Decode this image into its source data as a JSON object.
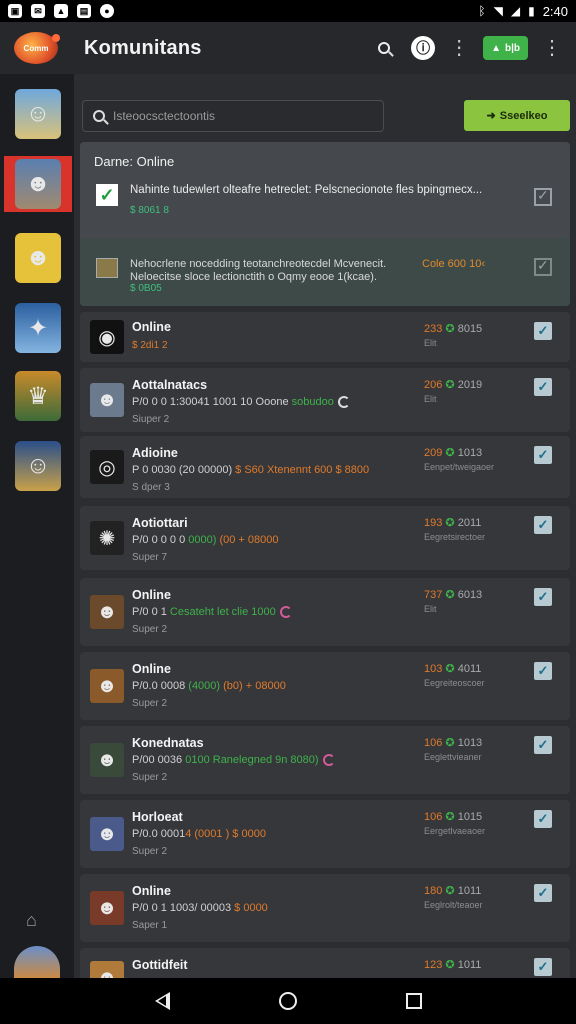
{
  "status_bar": {
    "time": "2:40",
    "icons": [
      "sim-icon",
      "gallery-icon",
      "alert-icon",
      "mail-icon",
      "record-icon"
    ],
    "right_icons": [
      "bluetooth-icon",
      "wifi-icon",
      "signal-icon",
      "battery-icon"
    ]
  },
  "app_bar": {
    "logo_text": "Comm",
    "title": "Komunitans",
    "badge_label": "b|b"
  },
  "rail": {
    "items": [
      "avatar-1",
      "avatar-2-active",
      "avatar-3",
      "avatar-4",
      "avatar-5",
      "avatar-6"
    ]
  },
  "search": {
    "placeholder": "Isteoocsctectoontis"
  },
  "primary_button": {
    "label": "Sseelkeo"
  },
  "pinned": {
    "title": "Darne: Online",
    "row1": {
      "text": "Nahinte tudewlert olteafre hetreclet: Pelscnecionote fles bpingmecx...",
      "meta": "$ 8061 8"
    },
    "row2": {
      "text": "Nehocrlene nocedding teotanchreotecdel Mcvenecit. Neloecitse sloce lectionctith o Oqmy eooe 1(kcae).",
      "orange": "Cole 600 10‹",
      "meta": "$ 0B05"
    }
  },
  "cards": [
    {
      "title": "Online",
      "line": "",
      "line_green": "",
      "line_orange": "",
      "sub": "$ 2di1 2",
      "sub_orange": true,
      "stat": "233",
      "stat_num": "8015",
      "stat2": "Elit"
    },
    {
      "title": "Aottalnatacs",
      "line": "P/0 0 0 1:30041 1001 10 Ooone",
      "line_green": " sobudoo",
      "line_orange": "",
      "sub": "Siuper 2",
      "sub_orange": false,
      "stat": "206",
      "stat_num": "2019",
      "stat2": "Elit"
    },
    {
      "title": "Adioine",
      "line": "P 0 0030 (20 00000) ",
      "line_green": "",
      "line_orange": "$ S60 Xtenennt 600 $ 8800",
      "sub": "S dper 3",
      "sub_orange": false,
      "stat": "209",
      "stat_num": "1013",
      "stat2": "Eenpet/tweigaoer"
    },
    {
      "title": "Aotiottari",
      "line": "P/0 0 0 0 0 ",
      "line_green": "0000)",
      "line_orange": " (00 + 08000",
      "sub": "Super 7",
      "sub_orange": false,
      "stat": "193",
      "stat_num": "2011",
      "stat2": "Eegretsirectoer"
    },
    {
      "title": "Online",
      "line": "P/0 0 1 ",
      "line_green": "Cesateht let clie 1000",
      "line_orange": "",
      "sub": "Super 2",
      "sub_orange": false,
      "stat": "737",
      "stat_num": "6013",
      "stat2": "Elit"
    },
    {
      "title": "Online",
      "line": "P/0.0 0008 ",
      "line_green": "(4000)",
      "line_orange": " (b0) + 08000",
      "sub": "Super 2",
      "sub_orange": false,
      "stat": "103",
      "stat_num": "4011",
      "stat2": "Eegreiteoscoer"
    },
    {
      "title": "Konednatas",
      "line": "P/00 0036 ",
      "line_green": "0100 Ranelegned 9n 8080)",
      "line_orange": "",
      "sub": "Super 2",
      "sub_orange": false,
      "stat": "106",
      "stat_num": "1013",
      "stat2": "Eeglettvieaner"
    },
    {
      "title": "Horloeat",
      "line": "P/0.0 0001",
      "line_green": "",
      "line_orange": "4 (0001 ) $ 0000",
      "sub": "Super 2",
      "sub_orange": false,
      "stat": "106",
      "stat_num": "1015",
      "stat2": "Eergetlvaeaoer"
    },
    {
      "title": "Online",
      "line": "P/0 0 1 1003/ 00003 ",
      "line_green": "",
      "line_orange": "$ 0000",
      "sub": "Saper 1",
      "sub_orange": false,
      "stat": "180",
      "stat_num": "1011",
      "stat2": "Eeglrolt/teaoer"
    },
    {
      "title": "Gottidfeit",
      "line": "",
      "line_green": "",
      "line_orange": "",
      "sub": "",
      "sub_orange": false,
      "stat": "123",
      "stat_num": "1011",
      "stat2": ""
    }
  ],
  "nav": {
    "back": "back-icon",
    "home": "home-icon",
    "recent": "recent-icon"
  },
  "colors": {
    "accent_green": "#8bc540",
    "badge_green": "#3fb24a",
    "active_red": "#d8342b",
    "orange": "#e07a2a"
  }
}
